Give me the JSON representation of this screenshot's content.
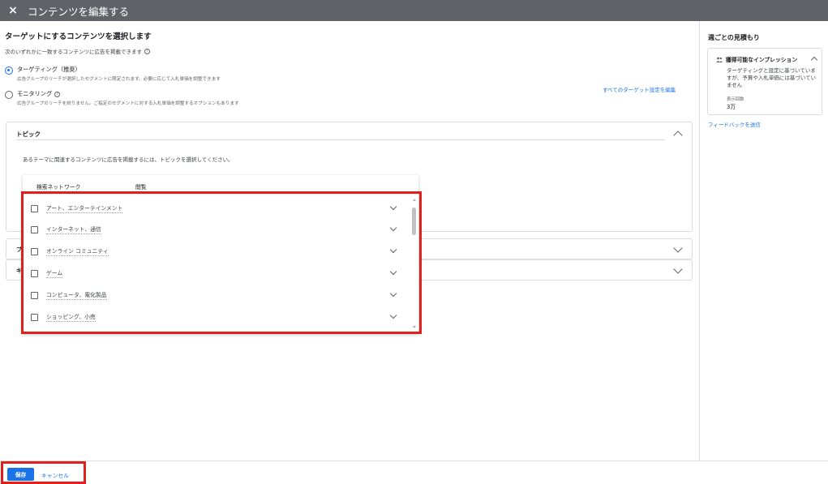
{
  "header": {
    "close_icon": "×",
    "title": "コンテンツを編集する"
  },
  "content": {
    "heading": "ターゲットにするコンテンツを選択します",
    "subheading": "次のいずれかに一致するコンテンツに広告を掲載できます",
    "options": [
      {
        "title": "ターゲティング（推奨）",
        "desc": "広告グループのリーチが選択したセグメントに限定されます。必要に応じて入札単価を調整できます",
        "selected": true
      },
      {
        "title": "モニタリング",
        "desc": "広告グループのリーチを絞りません。ご指定のセグメントに対する入札単価を調整するオプションもあります",
        "selected": false
      }
    ],
    "edit_all_link": "すべてのターゲット設定を編集",
    "topic": {
      "title": "トピック",
      "desc": "あるテーマに関連するコンテンツに広告を掲載するには、トピックを選択してください。",
      "tabs": [
        "検索ネットワーク",
        "閲覧"
      ],
      "active_tab": "閲覧",
      "items": [
        "アート、エンターテインメント",
        "インターネット、通信",
        "オンライン コミュニティ",
        "ゲーム",
        "コンピュータ、電化製品",
        "ショッピング、小売"
      ]
    },
    "collapsed_rows": [
      "プ",
      "キ"
    ]
  },
  "footer": {
    "save": "保存",
    "cancel": "キャンセル"
  },
  "right_panel": {
    "title": "週ごとの見積もり",
    "estimate": {
      "heading": "獲得可能なインプレッション",
      "text": "ターゲティングと設定に基づいていますが、予算や入札単価には基づいていません",
      "label": "表示回数",
      "value": "3万"
    },
    "feedback_link": "フィードバックを送信"
  },
  "colors": {
    "accent": "#1a73e8",
    "highlight": "#e0201c",
    "topbar": "#5f6368"
  }
}
